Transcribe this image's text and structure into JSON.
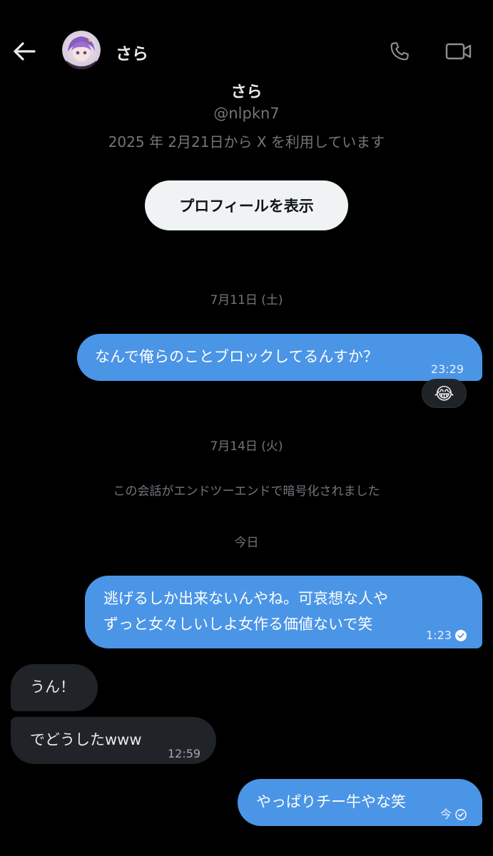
{
  "header": {
    "contact_name": "さら"
  },
  "profile": {
    "name": "さら",
    "handle": "@nlpkn7",
    "joined": "2025 年 2月21日から X を利用しています",
    "view_profile_label": "プロフィールを表示"
  },
  "conversation": {
    "date1": "7月11日 (土)",
    "msg1": {
      "text": "なんで俺らのことブロックしてるんすか？",
      "time": "23:29"
    },
    "msg1_reaction": "😂",
    "date2": "7月14日 (火)",
    "encryption_note": "この会話がエンドツーエンドで暗号化されました",
    "date3": "今日",
    "msg2": {
      "text": "逃げるしか出来ないんやね。可哀想な人やずっと女々しいしよ女作る価値ないで笑",
      "time": "1:23"
    },
    "msg3": {
      "text": "うん！"
    },
    "msg4": {
      "text": "でどうしたwww",
      "time": "12:59"
    },
    "msg5": {
      "text": "やっぱりチー牛やな笑",
      "time": "今"
    }
  },
  "icons": {
    "back": "arrow-left-icon",
    "call": "phone-icon",
    "video": "video-camera-icon",
    "read": "check-circle-icon"
  },
  "colors": {
    "background": "#000000",
    "sent_bubble": "#4b95e6",
    "received_bubble": "#202327",
    "secondary_text": "#71767b"
  }
}
